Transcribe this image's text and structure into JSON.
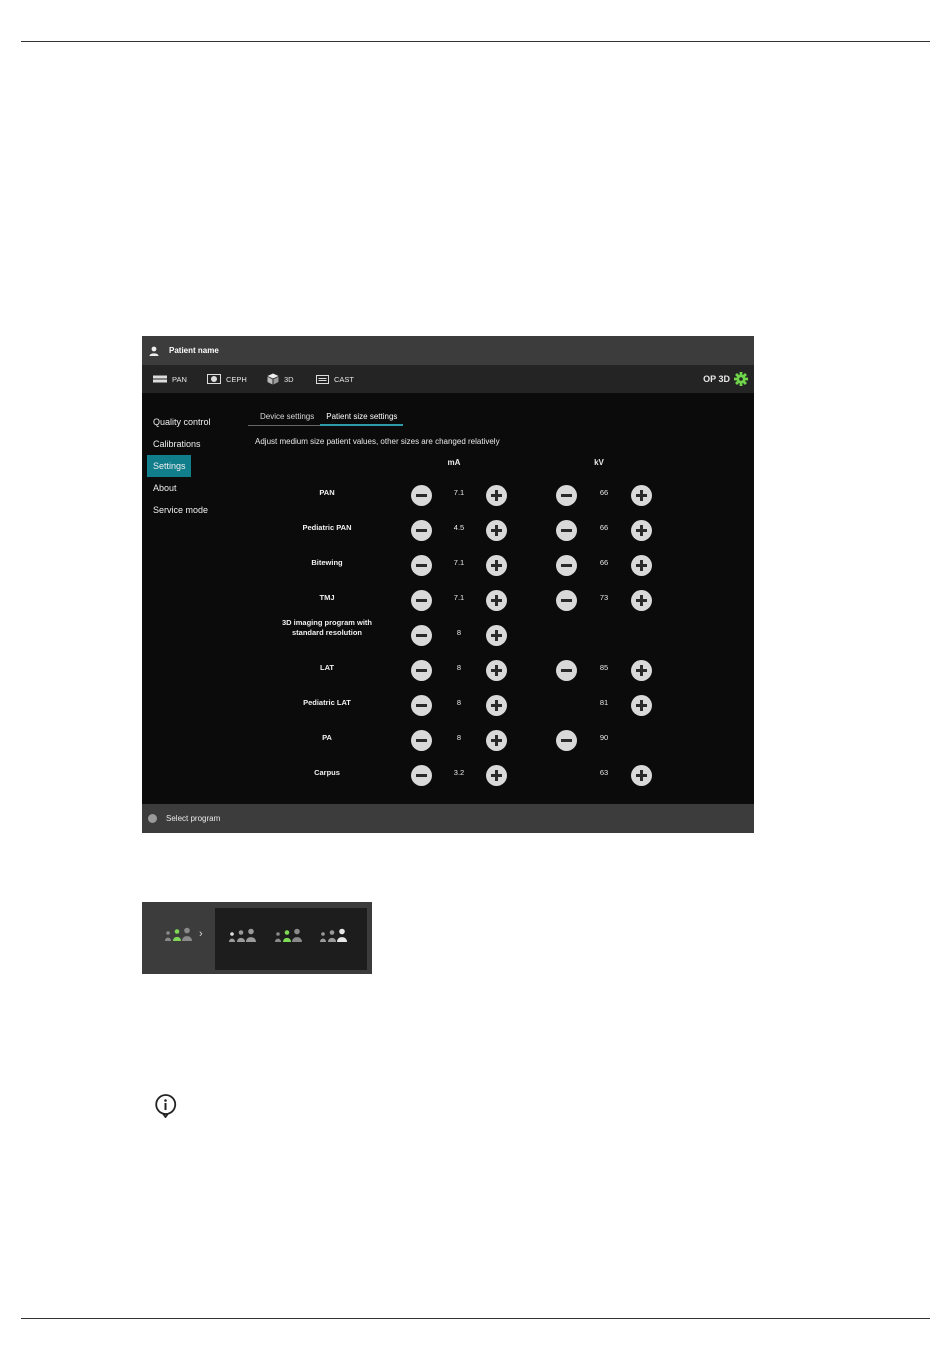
{
  "header": {
    "patient_label": "Patient name"
  },
  "modes": [
    "PAN",
    "CEPH",
    "3D",
    "CAST"
  ],
  "device": {
    "name": "OP 3D"
  },
  "sidebar": {
    "items": [
      "Quality control",
      "Calibrations",
      "Settings",
      "About",
      "Service mode"
    ],
    "active": "Settings"
  },
  "tabs": {
    "items": [
      "Device settings",
      "Patient size settings"
    ],
    "active": "Patient size settings"
  },
  "hint": "Adjust medium size patient values, other sizes are changed relatively",
  "columns": {
    "ma": "mA",
    "kv": "kV"
  },
  "programs": [
    {
      "label": "PAN",
      "ma": "7.1",
      "kv": "66"
    },
    {
      "label": "Pediatric PAN",
      "ma": "4.5",
      "kv": "66"
    },
    {
      "label": "Bitewing",
      "ma": "7.1",
      "kv": "66"
    },
    {
      "label": "TMJ",
      "ma": "7.1",
      "kv": "73"
    },
    {
      "label": "3D imaging program with\nstandard resolution",
      "ma": "8",
      "kv": ""
    },
    {
      "label": "LAT",
      "ma": "8",
      "kv": "85"
    },
    {
      "label": "Pediatric LAT",
      "ma": "8",
      "kv": "81"
    },
    {
      "label": "PA",
      "ma": "8",
      "kv": "90"
    },
    {
      "label": "Carpus",
      "ma": "3.2",
      "kv": "63"
    }
  ],
  "status": {
    "text": "Select program"
  },
  "patient_size_selector": {
    "current": "medium",
    "options": [
      "small",
      "medium",
      "large"
    ],
    "accent_color": "#7ed957"
  },
  "colors": {
    "accent": "#117e8c",
    "device_gear": "#6fd64a"
  }
}
